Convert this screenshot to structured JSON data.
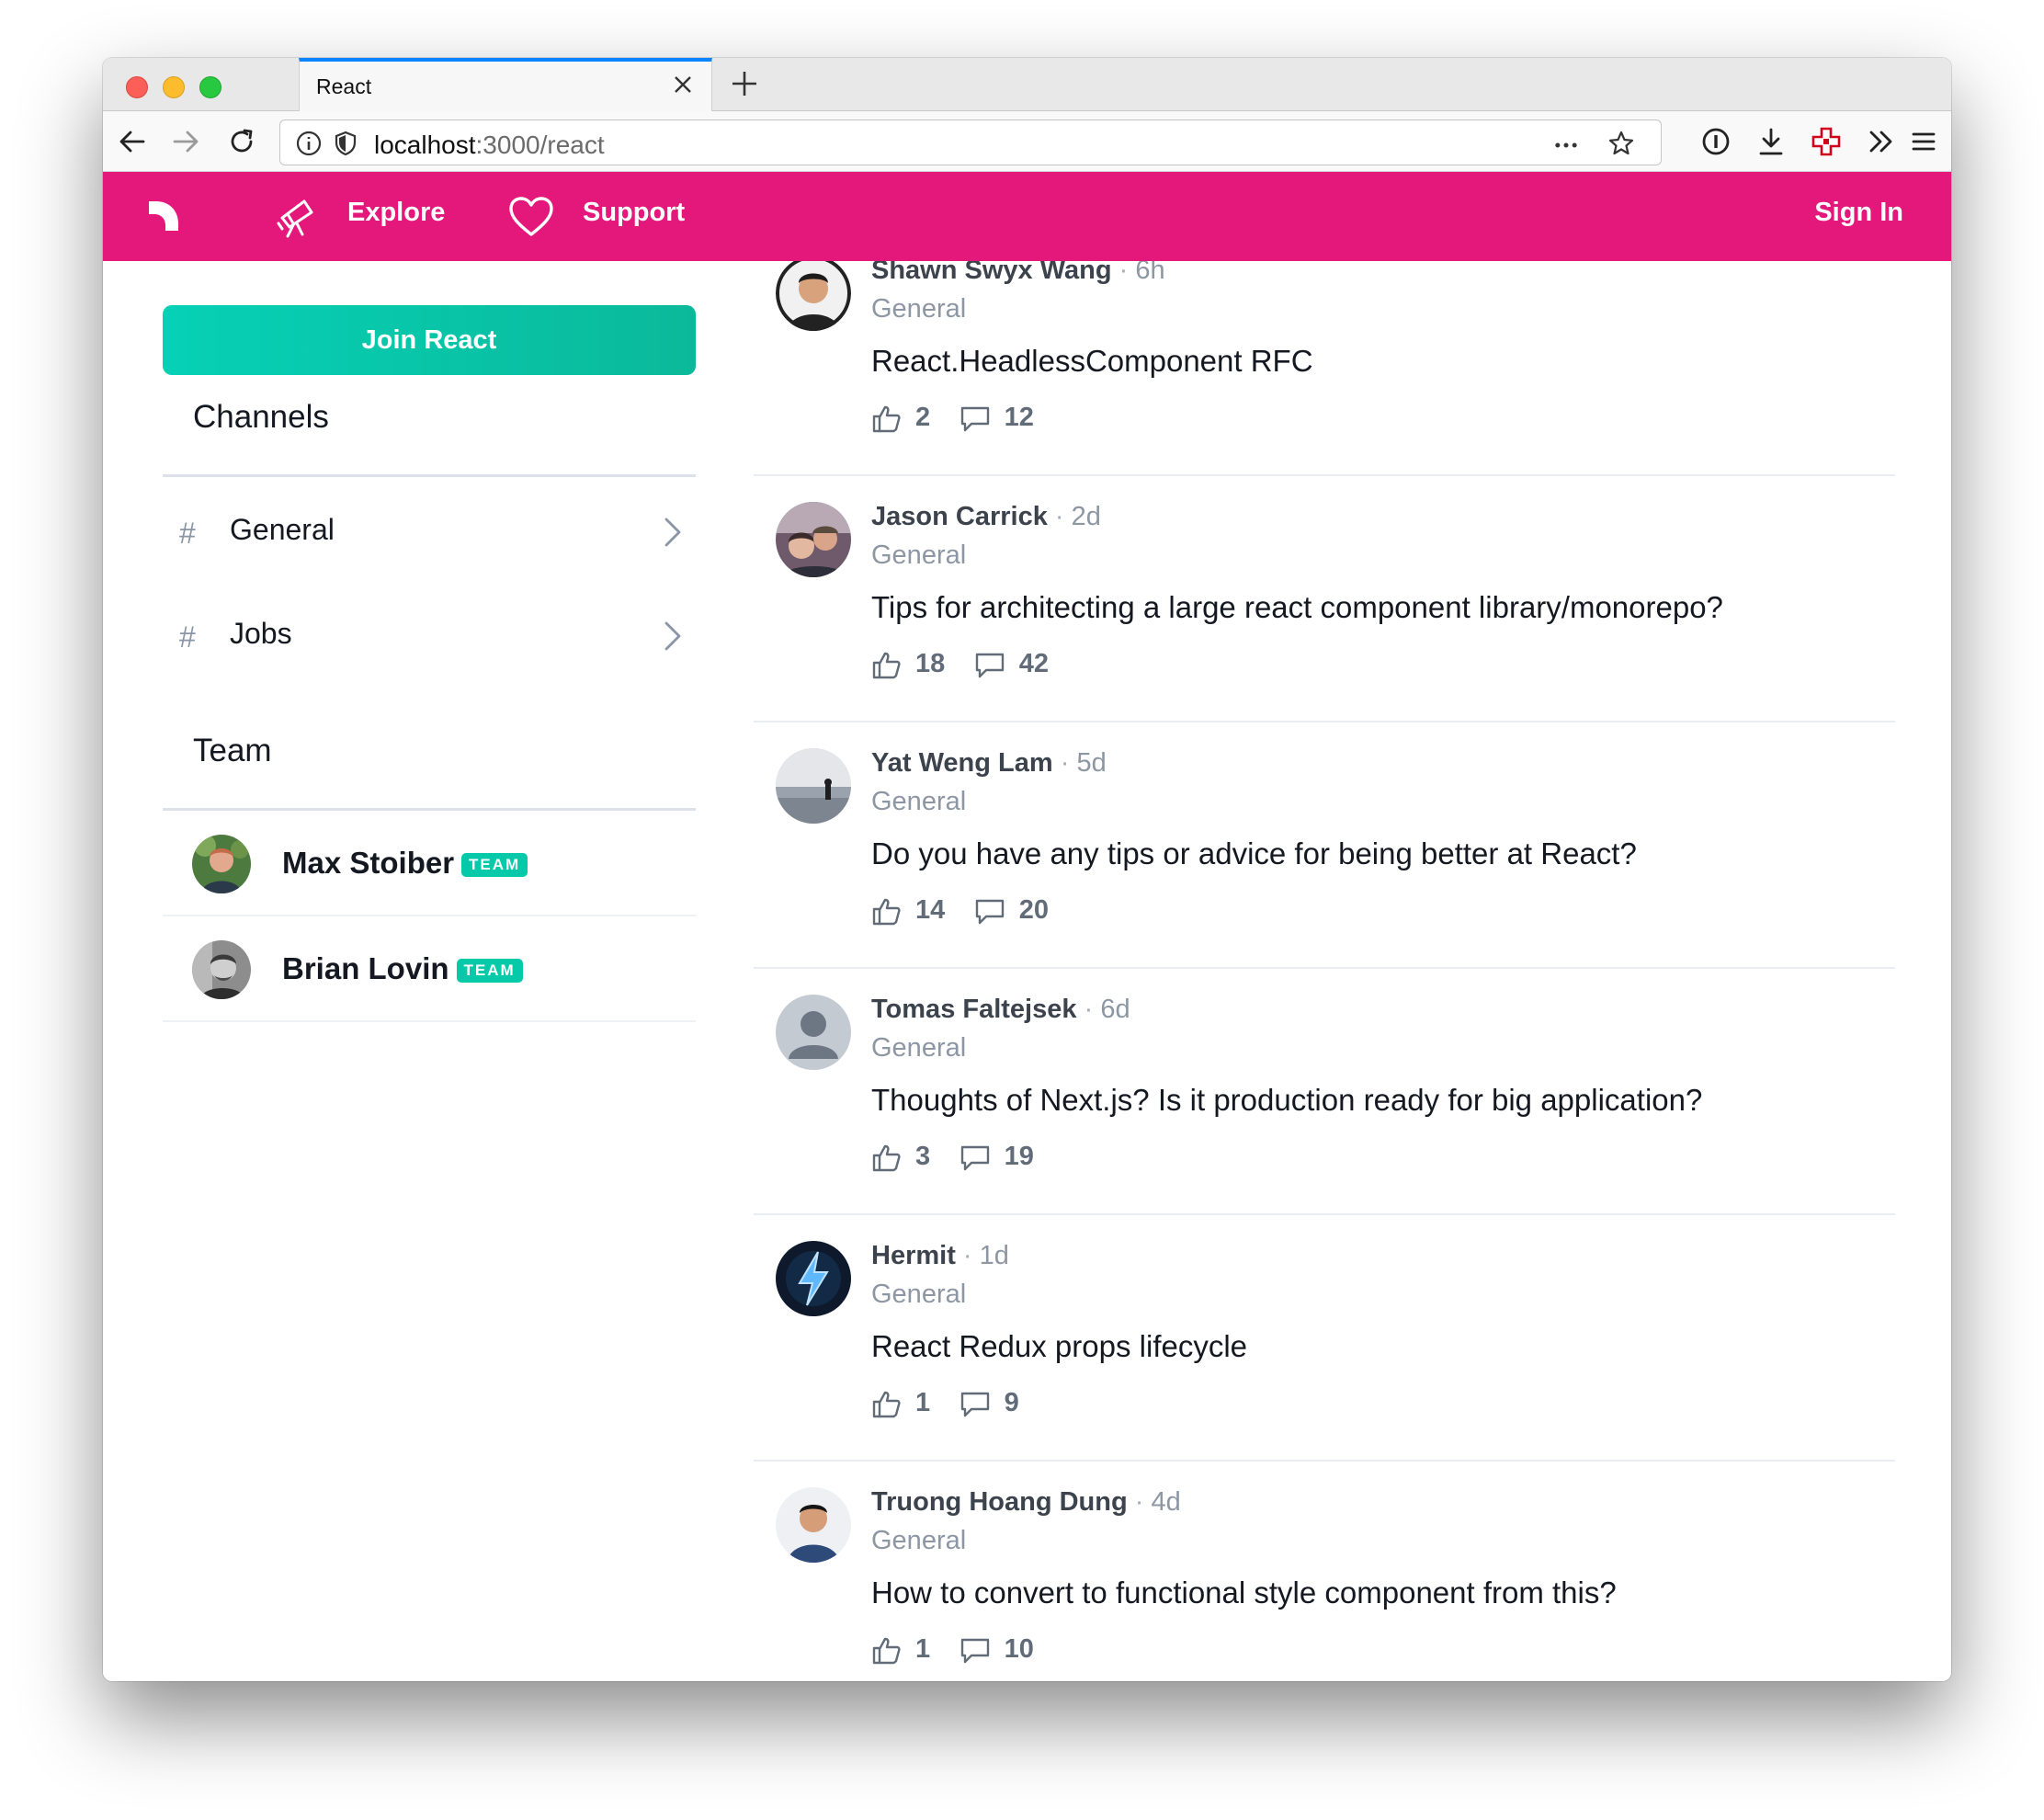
{
  "browser": {
    "tab_title": "React",
    "url_host": "localhost",
    "url_path": ":3000/react"
  },
  "nav": {
    "explore": "Explore",
    "support": "Support",
    "sign_in": "Sign In"
  },
  "sidebar": {
    "join_label": "Join React",
    "channels_title": "Channels",
    "channels": [
      {
        "hash": "#",
        "name": "General"
      },
      {
        "hash": "#",
        "name": "Jobs"
      }
    ],
    "team_title": "Team",
    "team": [
      {
        "name": "Max Stoiber",
        "badge": "TEAM"
      },
      {
        "name": "Brian Lovin",
        "badge": "TEAM"
      }
    ]
  },
  "feed": [
    {
      "author": "Shawn Swyx Wang",
      "age": "6h",
      "channel": "General",
      "title": "React.HeadlessComponent RFC",
      "likes": "2",
      "comments": "12"
    },
    {
      "author": "Jason Carrick",
      "age": "2d",
      "channel": "General",
      "title": "Tips for architecting a large react component library/monorepo?",
      "likes": "18",
      "comments": "42"
    },
    {
      "author": "Yat Weng Lam",
      "age": "5d",
      "channel": "General",
      "title": "Do you have any tips or advice for being better at React?",
      "likes": "14",
      "comments": "20"
    },
    {
      "author": "Tomas Faltejsek",
      "age": "6d",
      "channel": "General",
      "title": "Thoughts of Next.js? Is it production ready for big application?",
      "likes": "3",
      "comments": "19"
    },
    {
      "author": "Hermit",
      "age": "1d",
      "channel": "General",
      "title": "React Redux props lifecycle",
      "likes": "1",
      "comments": "9"
    },
    {
      "author": "Truong Hoang Dung",
      "age": "4d",
      "channel": "General",
      "title": "How to convert to functional style component from this?",
      "likes": "1",
      "comments": "10"
    }
  ],
  "colors": {
    "brand": "#e3187a",
    "join": "#06c9a9",
    "tab_accent": "#0a84ff"
  },
  "icons": {
    "explore": "telescope-icon",
    "support": "heart-icon",
    "likes": "thumbs-up-icon",
    "comments": "comment-bubble-icon"
  }
}
